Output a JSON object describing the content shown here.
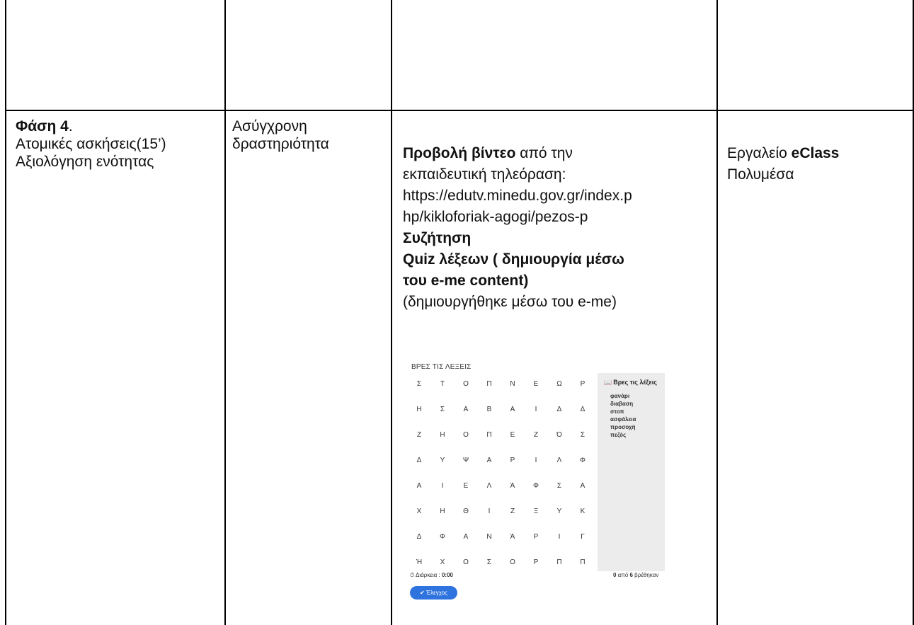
{
  "row1": {
    "phase_label": "Φάση 4",
    "phase_period": ".",
    "phase_lines": [
      "Ατομικές ασκήσεις(15’)",
      "Αξιολόγηση ενότητας"
    ],
    "mode_lines": [
      "Ασύγχρονη",
      "δραστηριότητα"
    ],
    "activity": {
      "video_bold": "Προβολή βίντεο",
      "video_rest": " από την",
      "line2": "εκπαιδευτική τηλεόραση:",
      "url_lines": [
        "https://edutv.minedu.gov.gr/index.p",
        "hp/kikloforiak-agogi/pezos-p"
      ],
      "discussion": "Συζήτηση",
      "quiz_lines": [
        "Quiz λέξεων ( δημιουργία μέσω",
        "του e-me content)"
      ],
      "note": "(δημιουργήθηκε μέσω του e-me)"
    },
    "tools": {
      "tool_prefix": "Εργαλείο ",
      "tool_bold": "eClass",
      "line2": "Πολυμέσα"
    }
  },
  "quiz": {
    "title": "ΒΡΕΣ ΤΙΣ ΛΕΞΕΙΣ",
    "grid": [
      [
        "Σ",
        "Τ",
        "Ο",
        "Π",
        "Ν",
        "Ε",
        "Ω",
        "Ρ"
      ],
      [
        "Η",
        "Σ",
        "Α",
        "Β",
        "Α",
        "Ι",
        "Δ",
        "Δ"
      ],
      [
        "Ζ",
        "Η",
        "Ο",
        "Π",
        "Ε",
        "Ζ",
        "Ό",
        "Σ"
      ],
      [
        "Δ",
        "Υ",
        "Ψ",
        "Α",
        "Ρ",
        "Ι",
        "Λ",
        "Φ"
      ],
      [
        "Α",
        "Ι",
        "Ε",
        "Λ",
        "Ά",
        "Φ",
        "Σ",
        "Α"
      ],
      [
        "Χ",
        "Η",
        "Θ",
        "Ι",
        "Ζ",
        "Ξ",
        "Υ",
        "Κ"
      ],
      [
        "Δ",
        "Φ",
        "Α",
        "Ν",
        "Ά",
        "Ρ",
        "Ι",
        "Γ"
      ],
      [
        "Ή",
        "Χ",
        "Ο",
        "Σ",
        "Ο",
        "Ρ",
        "Π",
        "Π"
      ]
    ],
    "panel_title": "Βρες τις λέξεις",
    "panel_icon": "book-icon",
    "words": [
      "φανάρι",
      "διαβαση",
      "στοπ",
      "ασφάλεια",
      "προσοχή",
      "πεζός"
    ],
    "duration_label": "Διάρκεια : ",
    "duration_value": "0:00",
    "found_count": "0",
    "found_mid": " από ",
    "found_total": "6",
    "found_suffix": " βρέθηκαν",
    "check_label": "Έλεγχος",
    "accent_color": "#2f74de"
  }
}
